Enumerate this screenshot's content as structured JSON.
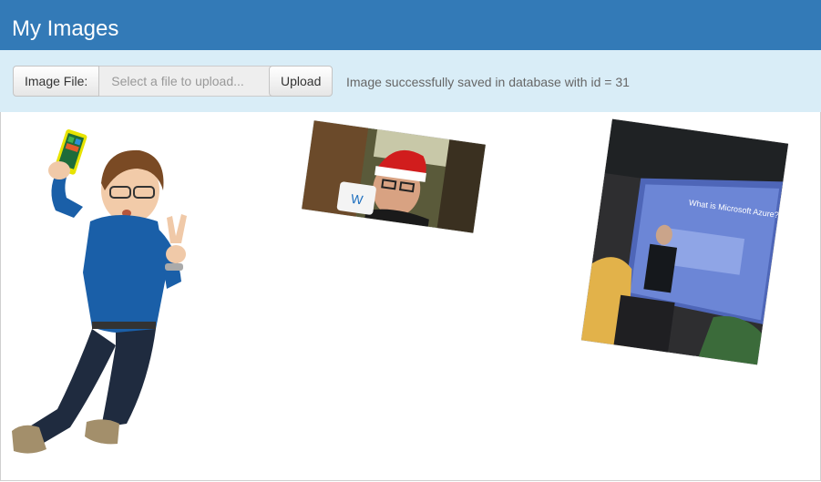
{
  "navbar": {
    "title": "My Images"
  },
  "upload": {
    "file_label": "Image File:",
    "file_placeholder": "Select a file to upload...",
    "upload_label": "Upload",
    "status": "Image successfully saved in database with id = 31"
  },
  "gallery": {
    "santa_mug_text": "W",
    "slide_title": "What is Microsoft Azure?"
  },
  "colors": {
    "navbar_bg": "#337ab7",
    "upload_bar_bg": "#d9edf7",
    "status_text": "#666666"
  }
}
